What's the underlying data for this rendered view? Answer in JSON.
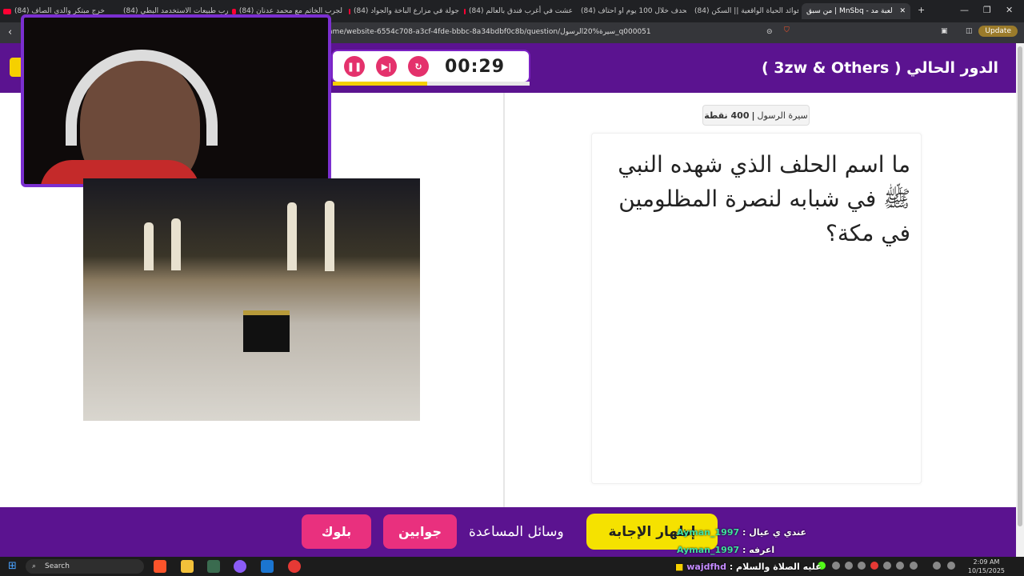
{
  "browser": {
    "tabs": [
      {
        "label": "(84) خرج مبتكر والدي الصاف"
      },
      {
        "label": "(84) تجارب طبيعات الاستخدمد البطي"
      },
      {
        "label": "(84) لجرب الخاتم مع محمد عدنان"
      },
      {
        "label": "(84) جولة في مزارع الباخة والجواد"
      },
      {
        "label": "(84) عشت في أغرب فندق بالعالم"
      },
      {
        "label": "(84) اتحدف خلال 100 يوم او احتاف"
      },
      {
        "label": "(84) فوائد الحياة الواقعية || السكن"
      },
      {
        "label": "من سبق | MnSbq - لعبة مد"
      }
    ],
    "url": "ame/website-6554c708-a3cf-4fde-bbbc-8a34bdbf0c8b/question/سيرة%20الرسول_q000051",
    "update_label": "Update"
  },
  "game": {
    "turn_title": "الدور الحالي ( 3zw & Others )",
    "timer": "00:29",
    "timer_progress": 0.48,
    "category": "سيرة الرسول",
    "points": "400 نقطة",
    "category_separator": "|",
    "question": "ما اسم الحلف الذي شهده النبي ﷺ في شبابه لنصرة المظلومين في مكة؟",
    "buttons": {
      "block": "بلوك",
      "holes": "جوابين",
      "helpers": "وسائل المساعدة",
      "reveal": "إظهار الإجابة"
    }
  },
  "chat": [
    {
      "user": "Ayman_1997",
      "message": "عندي ي عيال"
    },
    {
      "user": "Ayman_1997",
      "message": "اعرفه"
    },
    {
      "user": "wajdfhd",
      "message": "عليه الصلاة والسلام"
    }
  ],
  "taskbar": {
    "search_placeholder": "Search",
    "time": "2:09 AM",
    "date": "10/15/2025"
  },
  "colors": {
    "header_purple": "#5b1390",
    "accent_pink": "#e9307e",
    "accent_yellow": "#f5e200"
  }
}
